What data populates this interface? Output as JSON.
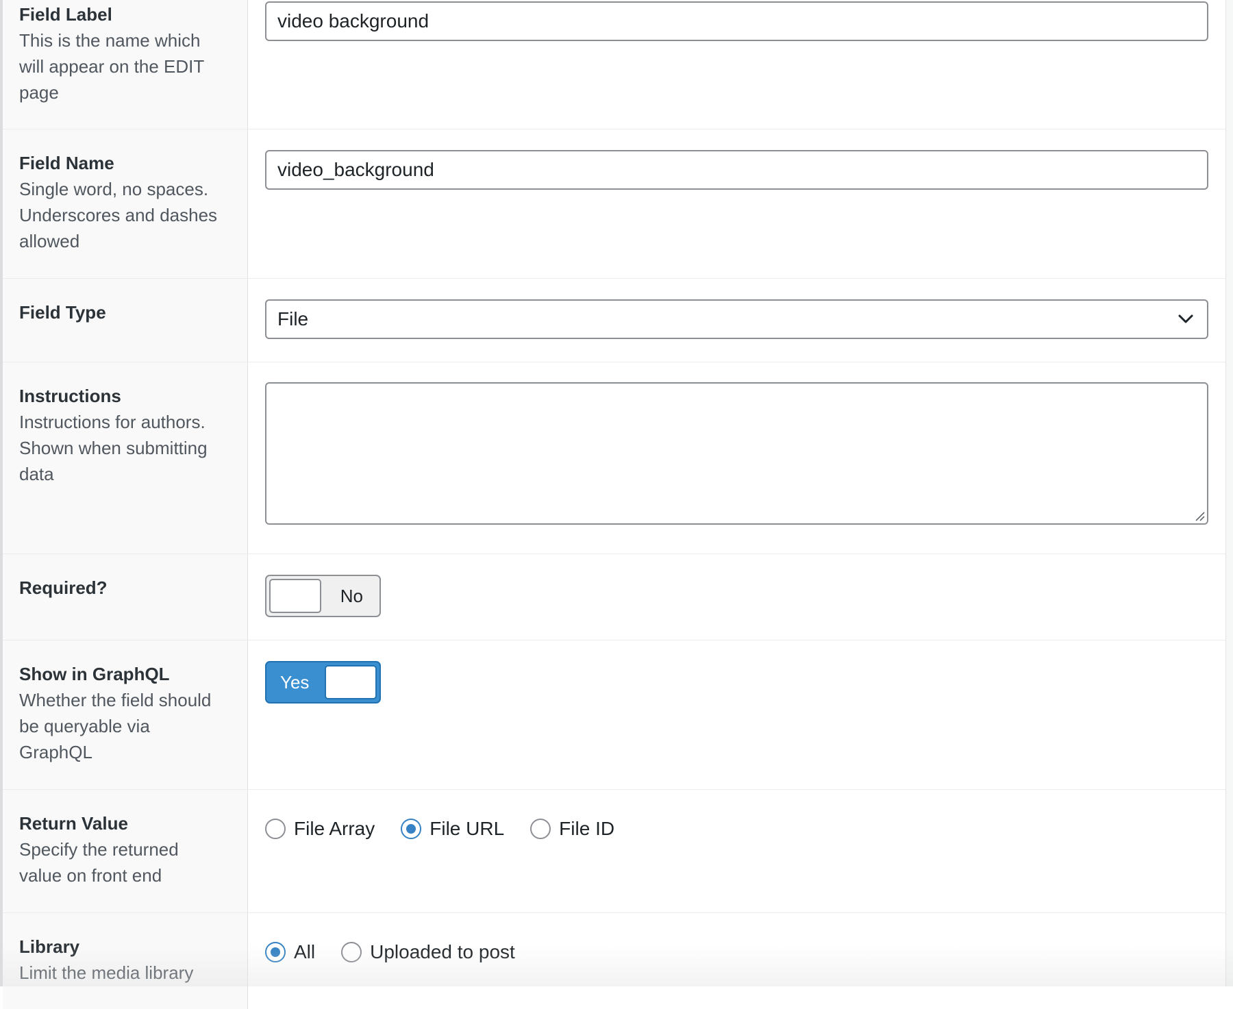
{
  "fields": {
    "field_label": {
      "title": "Field Label",
      "desc_lines": [
        "This is the name which",
        "will appear on the EDIT",
        "page"
      ],
      "value": "video background"
    },
    "field_name": {
      "title": "Field Name",
      "desc_lines": [
        "Single word, no spaces.",
        "Underscores and dashes",
        "allowed"
      ],
      "value": "video_background"
    },
    "field_type": {
      "title": "Field Type",
      "value": "File"
    },
    "instructions": {
      "title": "Instructions",
      "desc_lines": [
        "Instructions for authors.",
        "Shown when submitting",
        "data"
      ],
      "value": ""
    },
    "required": {
      "title": "Required?",
      "state_label": "No"
    },
    "show_in_graphql": {
      "title": "Show in GraphQL",
      "desc_lines": [
        "Whether the field should",
        "be queryable via",
        "GraphQL"
      ],
      "state_label": "Yes"
    },
    "return_value": {
      "title": "Return Value",
      "desc_lines": [
        "Specify the returned",
        "value on front end"
      ],
      "options": [
        "File Array",
        "File URL",
        "File ID"
      ],
      "selected": "File URL"
    },
    "library": {
      "title": "Library",
      "desc_lines": [
        "Limit the media library"
      ],
      "options": [
        "All",
        "Uploaded to post"
      ],
      "selected": "All"
    }
  },
  "colors": {
    "accent": "#3582c4",
    "toggle_on": "#3a8fd1",
    "border": "#8c8f94",
    "label_bg": "#f9f9f9"
  }
}
